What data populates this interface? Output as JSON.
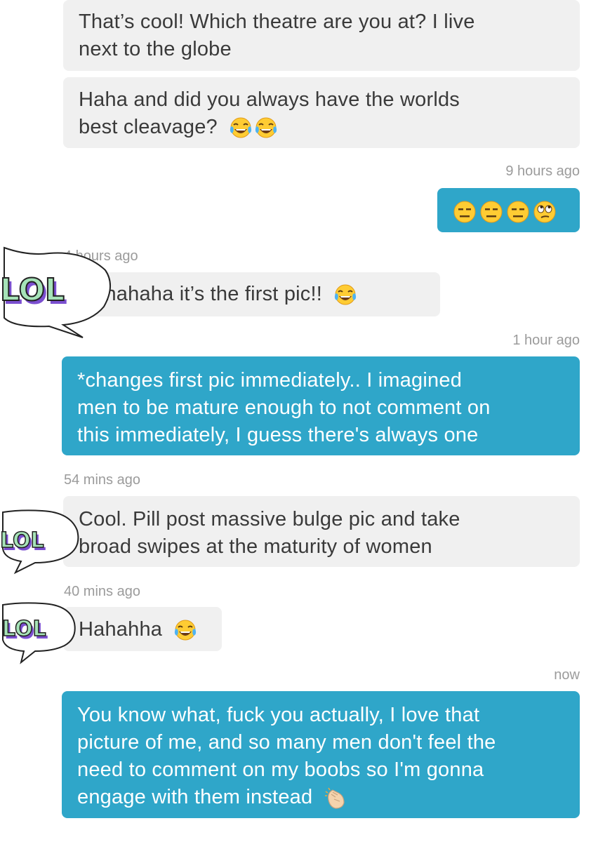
{
  "messages": [
    {
      "dir": "in",
      "lines": [
        "That’s cool! Which theatre are you at? I live",
        "next to the globe"
      ]
    },
    {
      "dir": "in",
      "lines": [
        "Haha and did you always have the worlds",
        "best cleavage?"
      ],
      "emoji": [
        "joy-face",
        "joy-face"
      ]
    },
    {
      "timestamp": "9 hours ago"
    },
    {
      "dir": "out",
      "emoji": [
        "expressionless-face",
        "expressionless-face",
        "expressionless-face",
        "eye-roll-face"
      ]
    },
    {
      "timestamp": "4 hours ago"
    },
    {
      "dir": "in",
      "lines": [
        "Hahahaha it’s the first pic!!"
      ],
      "emoji": [
        "joy-face"
      ]
    },
    {
      "timestamp": "1 hour ago"
    },
    {
      "dir": "out",
      "lines": [
        "*changes first pic immediately.. I imagined",
        "men to be mature enough to not comment on",
        "this immediately, I guess there's always one"
      ]
    },
    {
      "timestamp": "54 mins ago"
    },
    {
      "dir": "in",
      "lines": [
        "Cool. Pill post massive bulge pic and take",
        "broad swipes at the maturity of women"
      ]
    },
    {
      "timestamp": "40 mins ago"
    },
    {
      "dir": "in",
      "lines": [
        "Hahahha"
      ],
      "emoji": [
        "joy-face"
      ]
    },
    {
      "timestamp": "now"
    },
    {
      "dir": "out",
      "lines": [
        "You know what, fuck you actually, I love that",
        "picture of me, and so many men don't feel the",
        "need to comment on my boobs so I'm gonna",
        "engage with them instead"
      ],
      "emoji": [
        "clapping-hands"
      ]
    }
  ],
  "stickers": [
    {
      "text": "LOL",
      "colors": {
        "fill": "#a6e3b8",
        "shade": "#7b4fd0",
        "outline": "#222222"
      }
    },
    {
      "text": "LOL"
    },
    {
      "text": "LOL"
    }
  ],
  "colors": {
    "incoming": "#f0f0f0",
    "outgoing": "#2fa6c9",
    "timestamp": "#9b9b9b",
    "incoming_text": "#3a3a3a",
    "outgoing_text": "#ffffff"
  }
}
